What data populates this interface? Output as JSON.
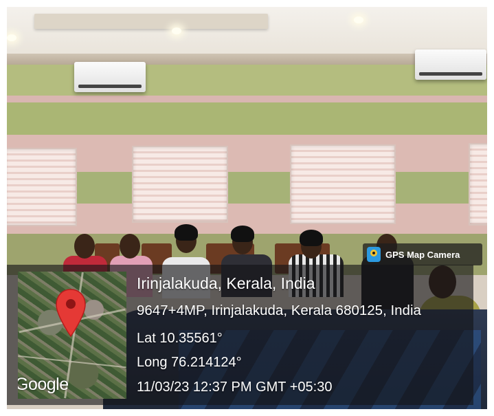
{
  "gps_badge": {
    "label": "GPS Map Camera",
    "icon": "gps-map-camera-icon"
  },
  "map": {
    "attribution": "Google",
    "pin_icon": "location-pin-icon",
    "pin_color": "#e53935"
  },
  "location": {
    "place": "Irinjalakuda, Kerala, India",
    "address": "9647+4MP, Irinjalakuda, Kerala 680125, India",
    "latitude": "Lat 10.35561°",
    "longitude": "Long 76.214124°",
    "datetime": "11/03/23 12:37 PM GMT +05:30"
  }
}
